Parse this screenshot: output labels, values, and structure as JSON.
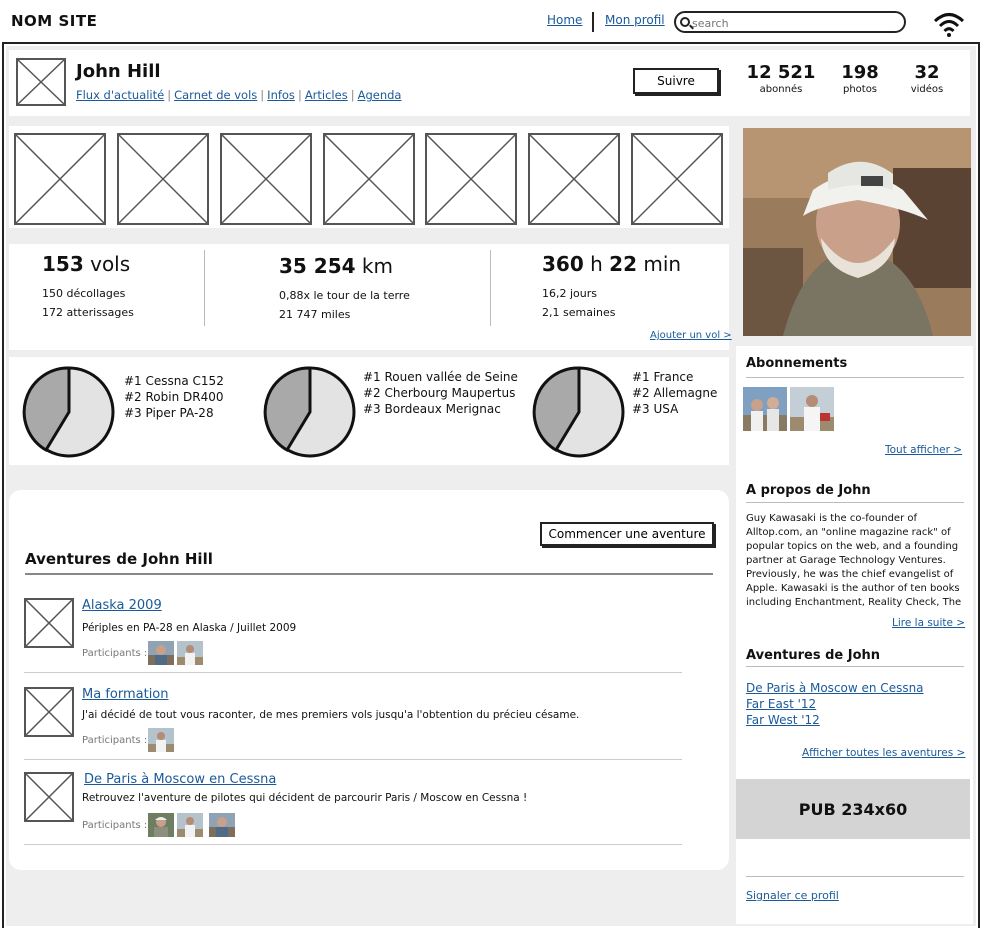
{
  "header": {
    "site_name": "NOM SITE",
    "nav_home": "Home",
    "nav_profile": "Mon profil",
    "search_placeholder": "search"
  },
  "profile": {
    "name": "John Hill",
    "links": [
      "Flux d'actualité",
      "Carnet de vols",
      "Infos",
      "Articles",
      "Agenda"
    ],
    "follow_label": "Suivre",
    "stats": [
      {
        "value": "12 521",
        "label": "abonnés"
      },
      {
        "value": "198",
        "label": "photos"
      },
      {
        "value": "32",
        "label": "vidéos"
      }
    ]
  },
  "kpis": {
    "flights": {
      "value": "153",
      "unit": "vols",
      "lines": [
        "150 décollages",
        "172 atterissages"
      ]
    },
    "distance": {
      "value": "35 254",
      "unit": "km",
      "lines": [
        "0,88x le tour de la terre",
        "21 747 miles"
      ]
    },
    "time": {
      "hours": "360",
      "h_unit": "h",
      "minutes": "22",
      "m_unit": "min",
      "lines": [
        "16,2 jours",
        "2,1 semaines"
      ]
    },
    "add_flight": "Ajouter un vol >"
  },
  "rankings": {
    "aircraft": [
      "#1 Cessna C152",
      "#2 Robin DR400",
      "#3 Piper PA-28"
    ],
    "routes": [
      "#1 Rouen vallée de Seine",
      "#2 Cherbourg Maupertus",
      "#3 Bordeaux Merignac"
    ],
    "countries": [
      "#1 France",
      "#2 Allemagne",
      "#3 USA"
    ]
  },
  "adventures": {
    "start_label": "Commencer une aventure",
    "title": "Aventures de John Hill",
    "participants_label": "Participants :",
    "items": [
      {
        "name": "Alaska 2009",
        "desc": "Périples en PA-28 en Alaska / Juillet 2009",
        "participants": 2
      },
      {
        "name": "Ma formation",
        "desc": "J'ai décidé de tout vous raconter, de mes premiers vols jusqu'a l'obtention du précieu césame.",
        "participants": 1
      },
      {
        "name": "De Paris à Moscow en Cessna",
        "desc": "Retrouvez l'aventure de pilotes qui décident de parcourir Paris / Moscow en Cessna !",
        "participants": 3
      }
    ]
  },
  "sidebar": {
    "subscriptions_title": "Abonnements",
    "show_all": "Tout afficher >",
    "about_title": "A propos de John",
    "about_text": "Guy Kawasaki is the co-founder of Alltop.com, an \"online magazine rack\" of popular topics on the web, and a founding partner at Garage Technology Ventures. Previously, he was the chief evangelist of Apple. Kawasaki is the author of ten books including Enchantment, Reality Check, The",
    "read_more": "Lire la suite >",
    "adventures_title": "Aventures de John",
    "adventure_links": [
      "De Paris à Moscow en Cessna",
      "Far East '12",
      "Far West '12"
    ],
    "all_adventures": "Afficher toutes les aventures >",
    "ad_label": "PUB 234x60",
    "report": "Signaler ce profil"
  }
}
